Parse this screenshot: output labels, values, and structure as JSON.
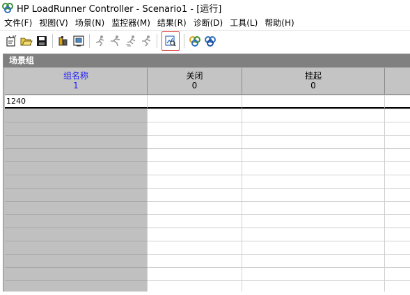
{
  "window": {
    "title": "HP LoadRunner Controller - Scenario1 - [运行]"
  },
  "menu": [
    {
      "label": "文件(F)"
    },
    {
      "label": "视图(V)"
    },
    {
      "label": "场景(N)"
    },
    {
      "label": "监控器(M)"
    },
    {
      "label": "结果(R)"
    },
    {
      "label": "诊断(D)"
    },
    {
      "label": "工具(L)"
    },
    {
      "label": "帮助(H)"
    }
  ],
  "toolbar": [
    {
      "icon": "new-scenario-icon"
    },
    {
      "icon": "open-folder-icon"
    },
    {
      "icon": "save-disk-icon"
    },
    {
      "icon": "design-icon"
    },
    {
      "icon": "run-view-icon"
    },
    {
      "icon": "run-user-icon"
    },
    {
      "icon": "gradual-run-icon"
    },
    {
      "icon": "stop-user-icon"
    },
    {
      "icon": "reset-user-icon"
    },
    {
      "icon": "analyze-results-icon"
    },
    {
      "icon": "agent-icon"
    },
    {
      "icon": "agent-refresh-icon"
    }
  ],
  "panel": {
    "title": "场景组"
  },
  "grid": {
    "columns": [
      {
        "name": "组名称",
        "count": "1"
      },
      {
        "name": "关闭",
        "count": "0"
      },
      {
        "name": "挂起",
        "count": "0"
      }
    ],
    "rows": [
      {
        "group": "1240"
      }
    ]
  },
  "colors": {
    "header_blue": "#1a1aff",
    "grid_gray": "#c0c0c0",
    "panel_title_bg": "#808080",
    "highlight_border": "#e05050"
  }
}
